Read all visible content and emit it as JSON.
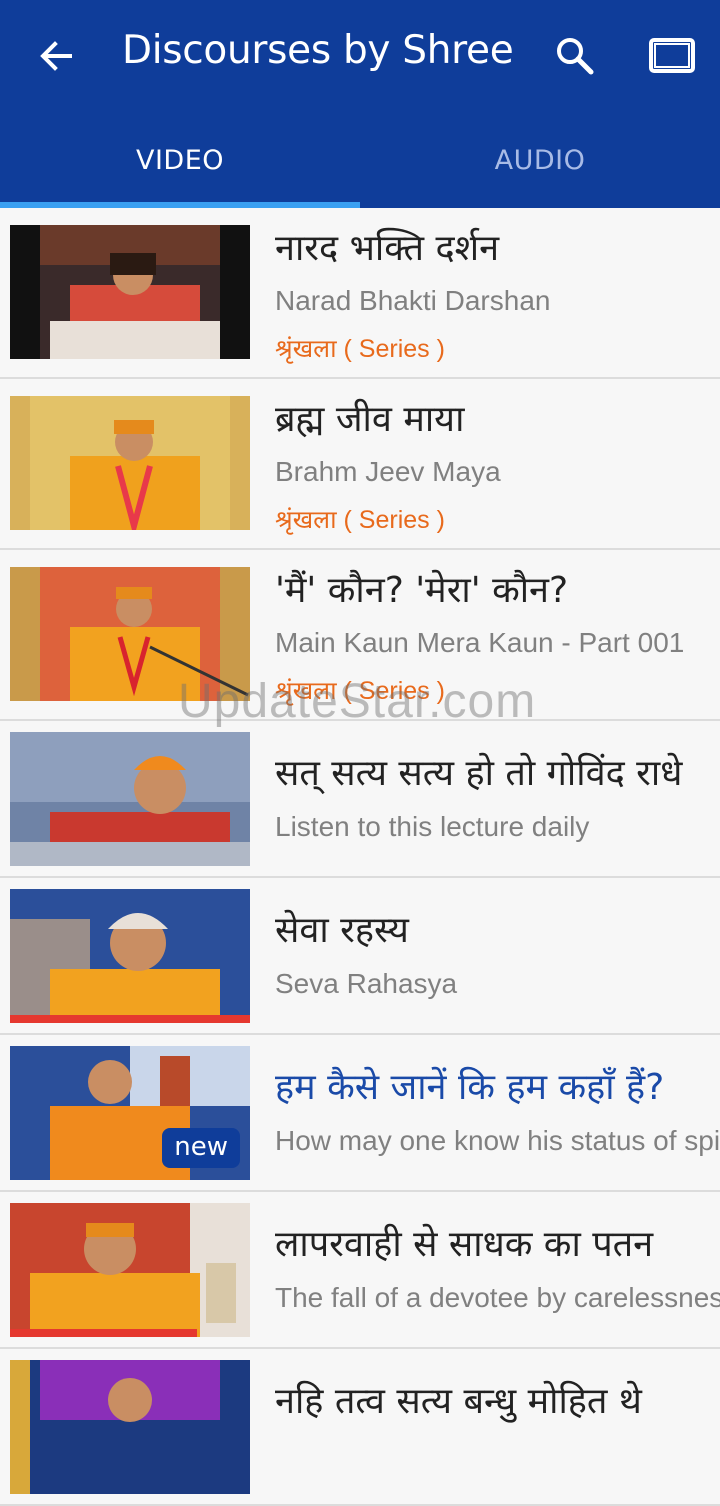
{
  "toolbar": {
    "title": "Discourses by Shree",
    "back_icon": "arrow-left-icon",
    "search_icon": "search-icon",
    "cast_icon": "screen-icon"
  },
  "tabs": [
    {
      "label": "VIDEO",
      "selected": true
    },
    {
      "label": "AUDIO",
      "selected": false
    }
  ],
  "colors": {
    "app_bar": "#0f3d9a",
    "tab_indicator": "#3aa0f2",
    "series_label": "#e86a1c",
    "progress": "#e5382f"
  },
  "videos": [
    {
      "title": "नारद भक्ति दर्शन",
      "subtitle": "Narad Bhakti Darshan",
      "series": "श्रृंखला ( Series )"
    },
    {
      "title": "ब्रह्म जीव माया",
      "subtitle": "Brahm Jeev Maya",
      "series": "श्रृंखला ( Series )"
    },
    {
      "title": "'मैं' कौन? 'मेरा' कौन?",
      "subtitle": "Main Kaun Mera Kaun - Part 001",
      "series": "श्रृंखला ( Series )"
    },
    {
      "title": "सत् सत्य सत्य हो  तो गोविंद राधे",
      "subtitle": "Listen to this lecture daily"
    },
    {
      "title": "सेवा रहस्य",
      "subtitle": "Seva Rahasya",
      "watched_fraction": 1.0
    },
    {
      "title": "हम कैसे जानें कि हम कहाँ हैं?",
      "subtitle": "How may one know his status of spiritual progress",
      "badge": "new",
      "highlighted": true
    },
    {
      "title": "लापरवाही से साधक का पतन",
      "subtitle": "The fall of a devotee by carelessness",
      "watched_fraction": 0.78
    },
    {
      "title": "नहि तत्व सत्य बन्धु मोहित थे"
    }
  ],
  "watermark": "UpdateStar.com"
}
